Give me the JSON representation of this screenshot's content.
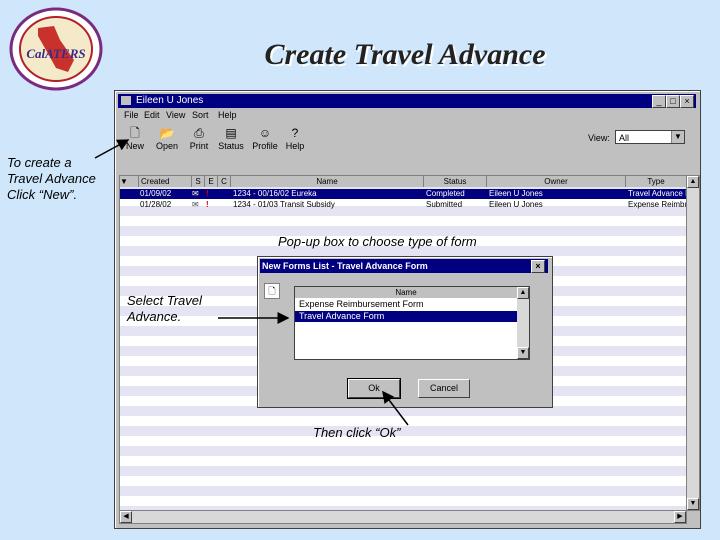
{
  "slide": {
    "title": "Create Travel Advance",
    "logo_text": "CalATERS",
    "captions": {
      "new_line1": "To create a",
      "new_line2": "Travel Advance",
      "new_line3": "Click “New”.",
      "popup": "Pop-up box to choose type of form",
      "select_line1": "Select Travel",
      "select_line2": "Advance.",
      "ok": "Then click “Ok”"
    }
  },
  "window": {
    "title": "Eileen U Jones",
    "menu": [
      "File",
      "Edit",
      "View",
      "Sort",
      "Help"
    ],
    "toolbar": [
      {
        "label": "New",
        "icon": "new-document-icon"
      },
      {
        "label": "Open",
        "icon": "open-folder-icon"
      },
      {
        "label": "Print",
        "icon": "printer-icon"
      },
      {
        "label": "Status",
        "icon": "status-icon"
      },
      {
        "label": "Profile",
        "icon": "person-icon"
      },
      {
        "label": "Help",
        "icon": "help-icon"
      }
    ],
    "view_label": "View:",
    "view_value": "All",
    "columns": [
      "Created",
      "S",
      "E",
      "C",
      "Name",
      "Status",
      "Owner",
      "Type"
    ],
    "rows": [
      {
        "created": "01/09/02",
        "name": "1234 - 00/16/02 Eureka",
        "status": "Completed",
        "owner": "Eileen U Jones",
        "type": "Travel Advance Fo"
      },
      {
        "created": "01/28/02",
        "name": "1234 - 01/03 Transit Subsidy",
        "status": "Submitted",
        "owner": "Eileen U Jones",
        "type": "Expense Reimbursed"
      }
    ]
  },
  "dialog": {
    "title": "New Forms List  -  Travel Advance Form",
    "list_header": "Name",
    "options": [
      "Expense Reimbursement Form",
      "Travel Advance Form"
    ],
    "selected_index": 1,
    "ok_label": "Ok",
    "cancel_label": "Cancel"
  },
  "colors": {
    "background": "#cfe6fb",
    "titlebar": "#000080",
    "window": "#c0c0c0"
  }
}
